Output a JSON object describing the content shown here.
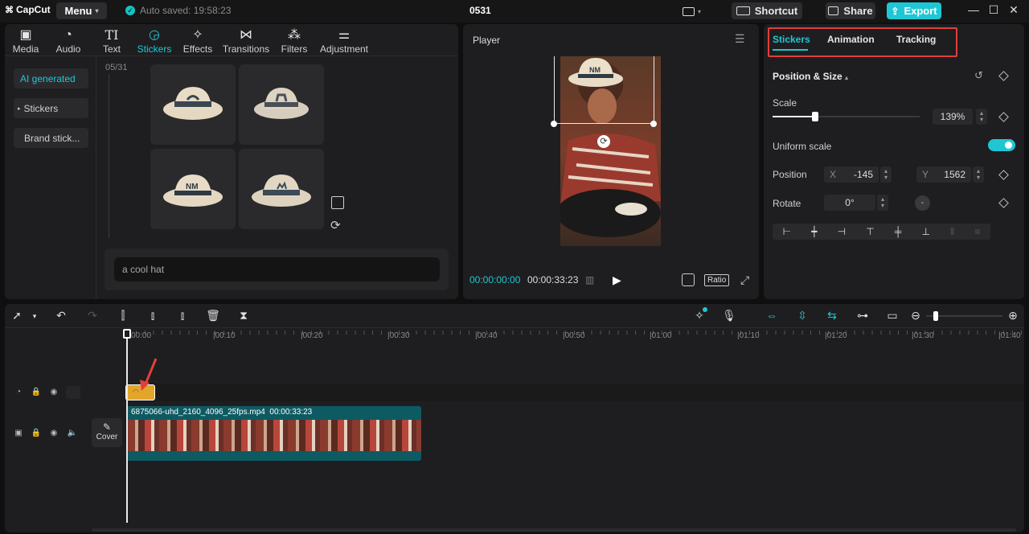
{
  "app": {
    "logo": "CapCut",
    "menu_label": "Menu",
    "autosave_text": "Auto saved: 19:58:23",
    "project_title": "0531",
    "shortcut_label": "Shortcut",
    "share_label": "Share",
    "export_label": "Export"
  },
  "tool_tabs": [
    {
      "label": "Media",
      "icon": "media-icon"
    },
    {
      "label": "Audio",
      "icon": "audio-icon"
    },
    {
      "label": "Text",
      "icon": "text-icon"
    },
    {
      "label": "Stickers",
      "icon": "stickers-icon"
    },
    {
      "label": "Effects",
      "icon": "effects-icon"
    },
    {
      "label": "Transitions",
      "icon": "transitions-icon"
    },
    {
      "label": "Filters",
      "icon": "filters-icon"
    },
    {
      "label": "Adjustment",
      "icon": "adjustment-icon"
    }
  ],
  "sidebar": {
    "items": [
      {
        "label": "AI generated"
      },
      {
        "label": "Stickers"
      },
      {
        "label": "Brand stick..."
      }
    ]
  },
  "stickers_panel": {
    "date_label": "05/31",
    "prompt_text": "a cool hat"
  },
  "player": {
    "label": "Player",
    "current_time": "00:00:00:00",
    "total_time": "00:00:33:23",
    "ratio_label": "Ratio"
  },
  "inspector": {
    "tabs": [
      {
        "label": "Stickers"
      },
      {
        "label": "Animation"
      },
      {
        "label": "Tracking"
      }
    ],
    "section_title": "Position & Size",
    "scale_label": "Scale",
    "scale_value": "139%",
    "scale_fraction": 0.28,
    "uniform_scale_label": "Uniform scale",
    "uniform_scale_on": true,
    "position_label": "Position",
    "position_x_label": "X",
    "position_x": "-145",
    "position_y_label": "Y",
    "position_y": "1562",
    "rotate_label": "Rotate",
    "rotate_value": "0°"
  },
  "timeline": {
    "ruler_ticks": [
      "00:00",
      "|00:10",
      "|00:20",
      "|00:30",
      "|00:40",
      "|00:50",
      "|01:00",
      "|01:10",
      "|01:20",
      "|01:30",
      "|01:40"
    ],
    "video_clip_name": "6875066-uhd_2160_4096_25fps.mp4",
    "video_clip_duration": "00:00:33:23",
    "cover_label": "Cover"
  },
  "colors": {
    "accent": "#1fc7d4",
    "highlight_box": "#e0403a",
    "sticker_clip": "#e3a52a",
    "video_clip": "#0e5a63"
  }
}
